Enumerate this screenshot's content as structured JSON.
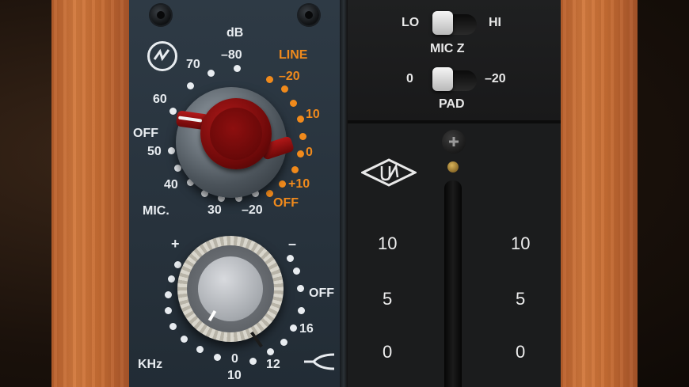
{
  "preamp": {
    "db_label": "dB",
    "line_label": "LINE",
    "mic_label": "MIC.",
    "mic_scale": [
      "70",
      "–80",
      "60",
      "OFF",
      "50",
      "40",
      "30",
      "–20"
    ],
    "line_scale": [
      "–20",
      "10",
      "0",
      "+10",
      "OFF"
    ]
  },
  "eq": {
    "plus_label": "+",
    "minus_label": "–",
    "off_label": "OFF",
    "khz_label": "KHz",
    "freq_scale": [
      "16",
      "12",
      "10",
      "0"
    ]
  },
  "switches": {
    "lo_label": "LO",
    "hi_label": "HI",
    "micz_label": "MIC Z",
    "pad_zero": "0",
    "pad_minus": "–20",
    "pad_label": "PAD"
  },
  "meter": {
    "left_scale": [
      "10",
      "5",
      "0"
    ],
    "right_scale": [
      "10",
      "5",
      "0"
    ]
  },
  "colors": {
    "panel": "#27323c",
    "accent_orange": "#f08a1c",
    "knob_red": "#8d0f0f",
    "wood": "#c76d33"
  },
  "icons": [
    "brand-logo-icon",
    "ua-logo-icon",
    "screw-icon",
    "filter-curve-icon"
  ]
}
